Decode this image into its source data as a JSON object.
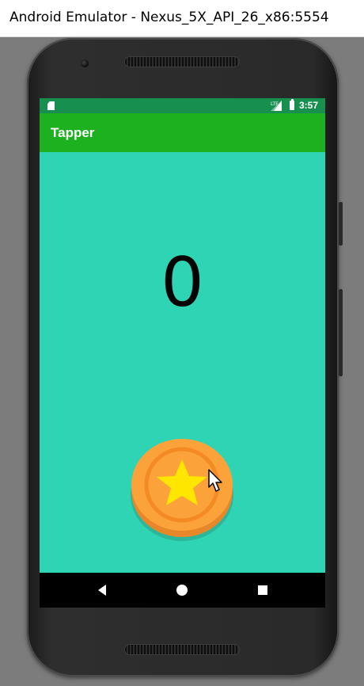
{
  "window": {
    "title": "Android Emulator - Nexus_5X_API_26_x86:5554"
  },
  "statusbar": {
    "time": "3:57",
    "network": "LTE"
  },
  "app": {
    "title": "Tapper",
    "background": "#2fd4b5",
    "appbar_color": "#1db120"
  },
  "counter": {
    "value": "0"
  },
  "coin": {
    "label": "coin-star"
  },
  "navbar": {
    "icons": [
      "back-icon",
      "home-icon",
      "recents-icon"
    ]
  }
}
